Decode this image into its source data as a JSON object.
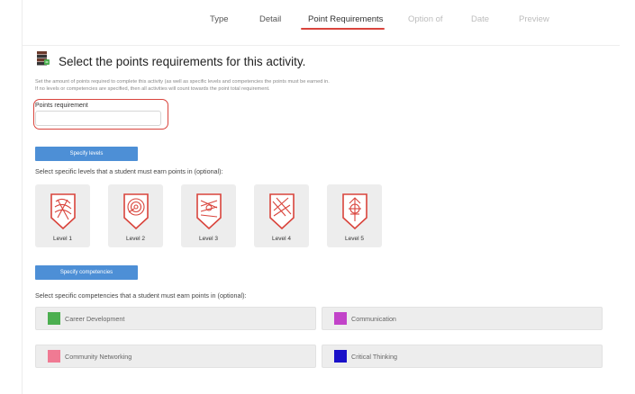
{
  "tabs": [
    {
      "label": "Type",
      "state": "normal"
    },
    {
      "label": "Detail",
      "state": "normal"
    },
    {
      "label": "Point Requirements",
      "state": "active"
    },
    {
      "label": "Option of",
      "state": "muted"
    },
    {
      "label": "Date",
      "state": "muted"
    },
    {
      "label": "Preview",
      "state": "muted"
    }
  ],
  "header": {
    "icon": "stacked-books-icon",
    "title": "Select the points requirements for this activity.",
    "description_line1": "Set the amount of points required to complete this activity (as well as specific levels and competencies the points must be earned in.",
    "description_line2": "If no levels or competencies are specified, then all activities will count towards the point total requirement."
  },
  "points": {
    "label": "Points requirement",
    "value": "",
    "placeholder": ""
  },
  "levels_section": {
    "button": "Specify levels",
    "prompt": "Select specific levels that a student must earn points in (optional):",
    "items": [
      {
        "label": "Level 1",
        "icon": "level-1-badge-icon"
      },
      {
        "label": "Level 2",
        "icon": "level-2-badge-icon"
      },
      {
        "label": "Level 3",
        "icon": "level-3-badge-icon"
      },
      {
        "label": "Level 4",
        "icon": "level-4-badge-icon"
      },
      {
        "label": "Level 5",
        "icon": "level-5-badge-icon"
      }
    ]
  },
  "competencies_section": {
    "button": "Specify competencies",
    "prompt": "Select specific competencies that a student must earn points in (optional):",
    "items": [
      {
        "label": "Career Development",
        "color": "#4caf50"
      },
      {
        "label": "Communication",
        "color": "#c243c9"
      },
      {
        "label": "Community Networking",
        "color": "#f07a93"
      },
      {
        "label": "Critical Thinking",
        "color": "#1a10c9"
      }
    ]
  },
  "colors": {
    "accent": "#d9443c",
    "button": "#4d8fd6",
    "badge": "#d9443c"
  }
}
